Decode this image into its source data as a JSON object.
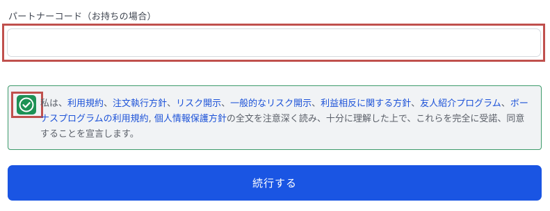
{
  "partner_code": {
    "label": "パートナーコード（お持ちの場合）",
    "value": "",
    "placeholder": ""
  },
  "consent": {
    "checked": true,
    "prefix": "私は、",
    "links": [
      "利用規約",
      "注文執行方針",
      "リスク開示",
      "一般的なリスク開示",
      "利益相反に関する方針",
      "友人紹介プログラム",
      "ボーナスプログラムの利用規約",
      "個人情報保護方針"
    ],
    "separator": "、",
    "separator_last": ", ",
    "suffix": "の全文を注意深く読み、十分に理解した上で、これらを完全に受諾、同意することを宣言します。"
  },
  "continue_button": {
    "label": "続行する"
  },
  "colors": {
    "accent_blue": "#1a55e3",
    "link_blue": "#1c52d8",
    "check_green": "#1d9155",
    "highlight_red": "#c0504d"
  }
}
